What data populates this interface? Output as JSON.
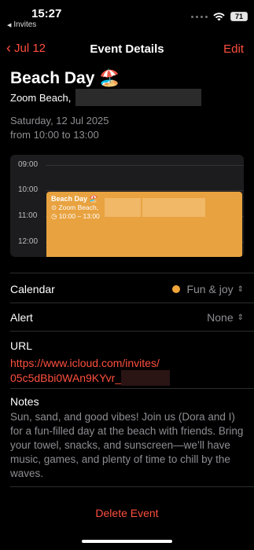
{
  "status_bar": {
    "time": "15:27",
    "back_app": "Invites",
    "battery": "71"
  },
  "nav": {
    "back_label": "Jul 12",
    "title": "Event Details",
    "edit_label": "Edit"
  },
  "event": {
    "title": "Beach Day 🏖️",
    "location": "Zoom Beach,",
    "date": "Saturday, 12 Jul 2025",
    "time_range": "from 10:00 to 13:00"
  },
  "timeline": {
    "hours": [
      "09:00",
      "10:00",
      "11:00",
      "12:00"
    ],
    "event_title": "Beach Day 🏖️",
    "event_location": "Zoom Beach,",
    "event_time": "10:00 – 13:00"
  },
  "calendar": {
    "label": "Calendar",
    "value": "Fun & joy",
    "color": "#f0a63a"
  },
  "alert": {
    "label": "Alert",
    "value": "None"
  },
  "url": {
    "label": "URL",
    "line1": "https://www.icloud.com/invites/",
    "line2": "05c5dBbi0WAn9KYvr_"
  },
  "notes": {
    "label": "Notes",
    "text": "Sun, sand, and good vibes! Join us (Dora and I) for a fun-filled day at the beach with friends. Bring your towel, snacks, and sunscreen—we’ll have music, games, and plenty of time to chill by the waves."
  },
  "delete_label": "Delete Event",
  "colors": {
    "accent": "#ff4f3f",
    "event": "#e8a23f"
  }
}
